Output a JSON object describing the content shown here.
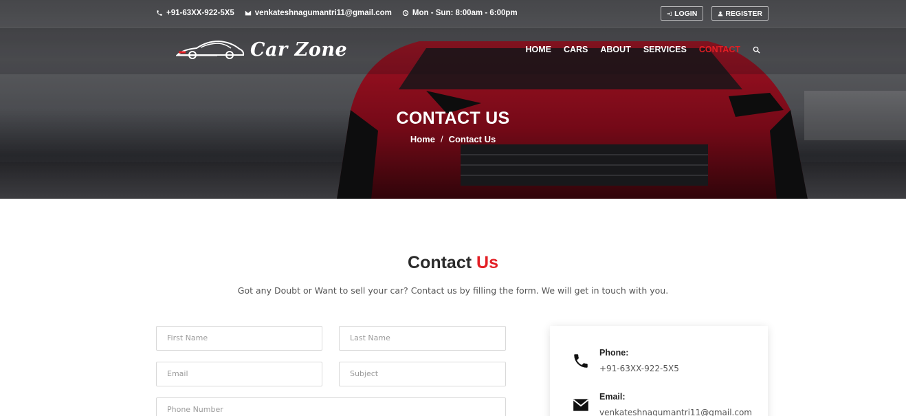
{
  "topbar": {
    "phone": "+91-63XX-922-5X5",
    "email": "venkateshnagumantri11@gmail.com",
    "hours": "Mon - Sun: 8:00am - 6:00pm",
    "login_label": "LOGIN",
    "register_label": "REGISTER"
  },
  "brand": {
    "name": "Car Zone"
  },
  "nav": {
    "items": [
      "HOME",
      "CARS",
      "ABOUT",
      "SERVICES",
      "CONTACT"
    ],
    "active": "CONTACT"
  },
  "hero": {
    "title": "CONTACT US",
    "breadcrumb": [
      "Home",
      "Contact Us"
    ],
    "separator": "/"
  },
  "section": {
    "title_main": "Contact ",
    "title_accent": "Us",
    "subtitle": "Got any Doubt or Want to sell your car? Contact us by filling the form. We will get in touch with you."
  },
  "form": {
    "first_name_placeholder": "First Name",
    "last_name_placeholder": "Last Name",
    "email_placeholder": "Email",
    "subject_placeholder": "Subject",
    "phone_placeholder": "Phone Number"
  },
  "contact_card": {
    "phone_label": "Phone:",
    "phone_value": "+91-63XX-922-5X5",
    "email_label": "Email:",
    "email_value": "venkateshnagumantri11@gmail.com"
  },
  "colors": {
    "accent": "#e31e24",
    "dark": "#2a2a2a"
  }
}
